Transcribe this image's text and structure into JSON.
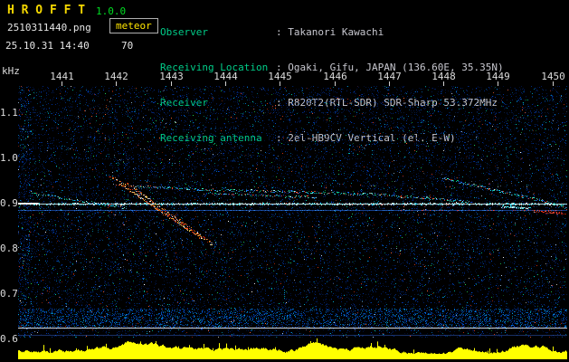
{
  "app": {
    "title": "H R O F F T",
    "version": "1.0.0",
    "filename": "2510311440.png",
    "mode": "meteor",
    "datetime": "25.10.31 14:40",
    "level": "70"
  },
  "info": {
    "rows": [
      {
        "label": "Observer",
        "value": ": Takanori Kawachi"
      },
      {
        "label": "Receiving Location",
        "value": ": Ogaki, Gifu, JAPAN (136.60E, 35.35N)"
      },
      {
        "label": "Receiver",
        "value": ": R820T2(RTL-SDR) SDR-Sharp 53.372MHz"
      },
      {
        "label": "Receiving antenna",
        "value": ": 2el-HB9CV Vertical (el. E-W)"
      }
    ]
  },
  "spectrogram": {
    "y_unit": "kHz",
    "y_ticks": [
      "1.1",
      "1.0",
      "0.9",
      "0.8",
      "0.7",
      "0.6"
    ],
    "x_ticks": [
      "1441",
      "1442",
      "1443",
      "1444",
      "1445",
      "1446",
      "1447",
      "1448",
      "1449",
      "1450"
    ],
    "time_start": "14:40",
    "time_end": "14:50",
    "freq_top_khz": 1.16,
    "freq_bottom_khz": 0.604,
    "carrier_khz": 0.9,
    "noise_colors": [
      [
        "#001240",
        26
      ],
      [
        "#001d66",
        22
      ],
      [
        "#002a8c",
        16
      ],
      [
        "#0038b3",
        12
      ],
      [
        "#0050d9",
        8
      ],
      [
        "#0077cc",
        5
      ],
      [
        "#00a8cc",
        4
      ],
      [
        "#00ccaa",
        2
      ],
      [
        "#22cc55",
        1.5
      ],
      [
        "#cc3311",
        2
      ],
      [
        "#ff6633",
        0.8
      ],
      [
        "#aaccee",
        1.2
      ],
      [
        "#ffffff",
        0.5
      ]
    ],
    "palettes": {
      "warm": [
        "#ff4422",
        "#ff6a00",
        "#ffaa33",
        "#ffdd66",
        "#ffffff",
        "#dd2200"
      ],
      "cool": [
        "#00d9ff",
        "#33ffcc",
        "#55aaff",
        "#00cc88",
        "#bbffee",
        "#2266ff",
        "#ff5533"
      ],
      "bright": [
        "#ffffff",
        "#ccffff",
        "#00eaff"
      ],
      "red": [
        "#ff3322",
        "#ff6644",
        "#cc2200"
      ]
    },
    "h_lines": [
      {
        "f": 0.9,
        "style": "carrier"
      },
      {
        "f": 0.886,
        "style": "faint"
      },
      {
        "f": 0.626,
        "style": "white"
      },
      {
        "f": 0.61,
        "style": "dim"
      }
    ],
    "traces": [
      {
        "palette": "warm",
        "density": 1.5,
        "pts": [
          [
            2.06,
            0.944
          ],
          [
            3.6,
            0.82
          ]
        ]
      },
      {
        "palette": "warm",
        "density": 1.2,
        "pts": [
          [
            2.32,
            0.934
          ],
          [
            3.76,
            0.81
          ]
        ]
      },
      {
        "palette": "warm",
        "density": 0.8,
        "pts": [
          [
            1.86,
            0.96
          ],
          [
            2.35,
            0.934
          ]
        ]
      },
      {
        "palette": "cool",
        "density": 0.8,
        "pts": [
          [
            0.45,
            0.924
          ],
          [
            2.19,
            0.89
          ]
        ]
      },
      {
        "palette": "cool",
        "density": 0.9,
        "pts": [
          [
            2.35,
            0.938
          ],
          [
            3.76,
            0.93
          ],
          [
            5.17,
            0.926
          ],
          [
            6.83,
            0.92
          ],
          [
            7.66,
            0.912
          ],
          [
            8.49,
            0.904
          ]
        ]
      },
      {
        "palette": "cool",
        "density": 0.7,
        "pts": [
          [
            3.68,
            0.922
          ],
          [
            5.67,
            0.914
          ]
        ]
      },
      {
        "palette": "cool",
        "density": 1.0,
        "pts": [
          [
            7.99,
            0.956
          ],
          [
            9.07,
            0.926
          ],
          [
            9.82,
            0.906
          ],
          [
            10.3,
            0.888
          ]
        ]
      },
      {
        "palette": "bright",
        "density": 2.2,
        "pts": [
          [
            9.07,
            0.894
          ],
          [
            9.57,
            0.889
          ]
        ]
      },
      {
        "palette": "red",
        "density": 1.6,
        "pts": [
          [
            9.65,
            0.884
          ],
          [
            10.23,
            0.878
          ]
        ]
      }
    ],
    "level": {
      "base": 9,
      "bumps": [
        {
          "t": 2.44,
          "h": 9,
          "w": 0.35
        },
        {
          "t": 5.59,
          "h": 6,
          "w": 0.2
        },
        {
          "t": 6.83,
          "h": 4,
          "w": 0.2
        },
        {
          "t": 9.57,
          "h": 7,
          "w": 0.3
        }
      ]
    }
  }
}
